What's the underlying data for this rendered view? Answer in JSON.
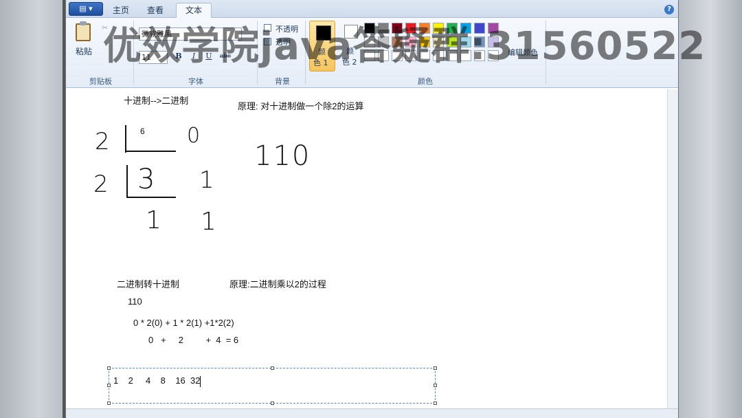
{
  "tabs": {
    "app_menu": "▤ ▾",
    "home": "主页",
    "view": "查看",
    "text": "文本",
    "help": "?"
  },
  "ribbon": {
    "clipboard": {
      "paste": "粘贴",
      "group": "剪贴板"
    },
    "font": {
      "family": "微软雅黑",
      "size": "11",
      "bold": "B",
      "italic": "I",
      "underline": "U",
      "strike": "abc",
      "group": "字体"
    },
    "background": {
      "opaque": "不透明",
      "transparent": "透明",
      "group": "背景"
    },
    "colors": {
      "color1_a": "颜",
      "color1_b": "色 1",
      "color2_a": "颜",
      "color2_b": "色 2",
      "edit": "编辑颜色",
      "group": "颜色",
      "palette_row1": [
        "#000000",
        "#7f7f7f",
        "#880015",
        "#ed1c24",
        "#ff7f27",
        "#fff200",
        "#22b14c",
        "#00a2e8",
        "#3f48cc",
        "#a349a4"
      ],
      "palette_row2": [
        "#ffffff",
        "#c3c3c3",
        "#b97a57",
        "#ffaec9",
        "#ffc90e",
        "#efe4b0",
        "#b5e61d",
        "#99d9ea",
        "#7092be",
        "#c8bfe7"
      ],
      "palette_row3": [
        "#ffffff",
        "#ffffff",
        "#ffffff",
        "#ffffff",
        "#ffffff",
        "#ffffff",
        "#ffffff",
        "#ffffff",
        "#ffffff",
        "#ffffff"
      ]
    }
  },
  "watermark": "优效学院java答疑群:31560522",
  "canvas": {
    "title1": "十进制-->二进制",
    "principle1": "原理: 对十进制做一个除2的运算",
    "hand": {
      "two_a": "2",
      "six": "6",
      "zero_a": "0",
      "two_b": "2",
      "three": "3",
      "one_a": "1",
      "one_b": "1",
      "one_c": "1",
      "result": "110"
    },
    "title2": "二进制转十进制",
    "principle2": "原理:二进制乘以2的过程",
    "num": "110",
    "formula": "0 * 2(0) + 1 * 2(1) +1*2(2)",
    "sum": "0   +     2         +  4  = 6",
    "powers": "1    2     4    8    16  32"
  }
}
